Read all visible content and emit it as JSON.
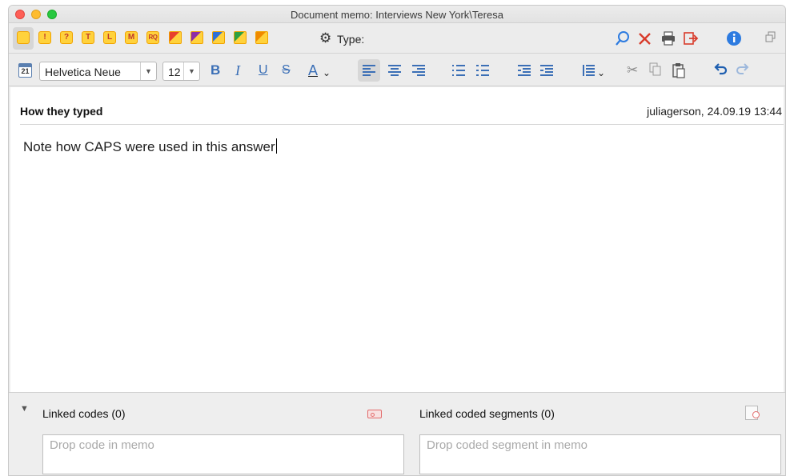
{
  "window": {
    "title": "Document memo: Interviews New York\\Teresa"
  },
  "toolbar1": {
    "memo_types": [
      {
        "name": "memo-plain",
        "symbol": ""
      },
      {
        "name": "memo-exclamation",
        "symbol": "!"
      },
      {
        "name": "memo-question",
        "symbol": "?"
      },
      {
        "name": "memo-t",
        "symbol": "T"
      },
      {
        "name": "memo-l",
        "symbol": "L"
      },
      {
        "name": "memo-m",
        "symbol": "M"
      },
      {
        "name": "memo-rq",
        "symbol": "RQ"
      }
    ],
    "color_memos": [
      "#e8412c",
      "#8e2da6",
      "#2f6fd6",
      "#2ea043",
      "#f08a00"
    ],
    "type_label": "Type:"
  },
  "toolbar2": {
    "calendar_day": "21",
    "font_family": "Helvetica Neue",
    "font_size": "12",
    "bold": "B",
    "italic": "I",
    "underline": "U",
    "strike": "S",
    "font_color": "A"
  },
  "memo": {
    "title": "How they typed",
    "meta": "juliagerson, 24.09.19 13:44",
    "body": "Note how CAPS were used in this answer"
  },
  "linked_codes": {
    "label": "Linked codes (0)",
    "placeholder": "Drop code in memo"
  },
  "linked_segments": {
    "label": "Linked coded segments (0)",
    "placeholder": "Drop coded segment in memo"
  },
  "colors": {
    "accent_blue": "#3b6fb6",
    "memo_yellow": "#ffd23c",
    "delete_red": "#d83b2b",
    "info_blue": "#2d7be0"
  }
}
